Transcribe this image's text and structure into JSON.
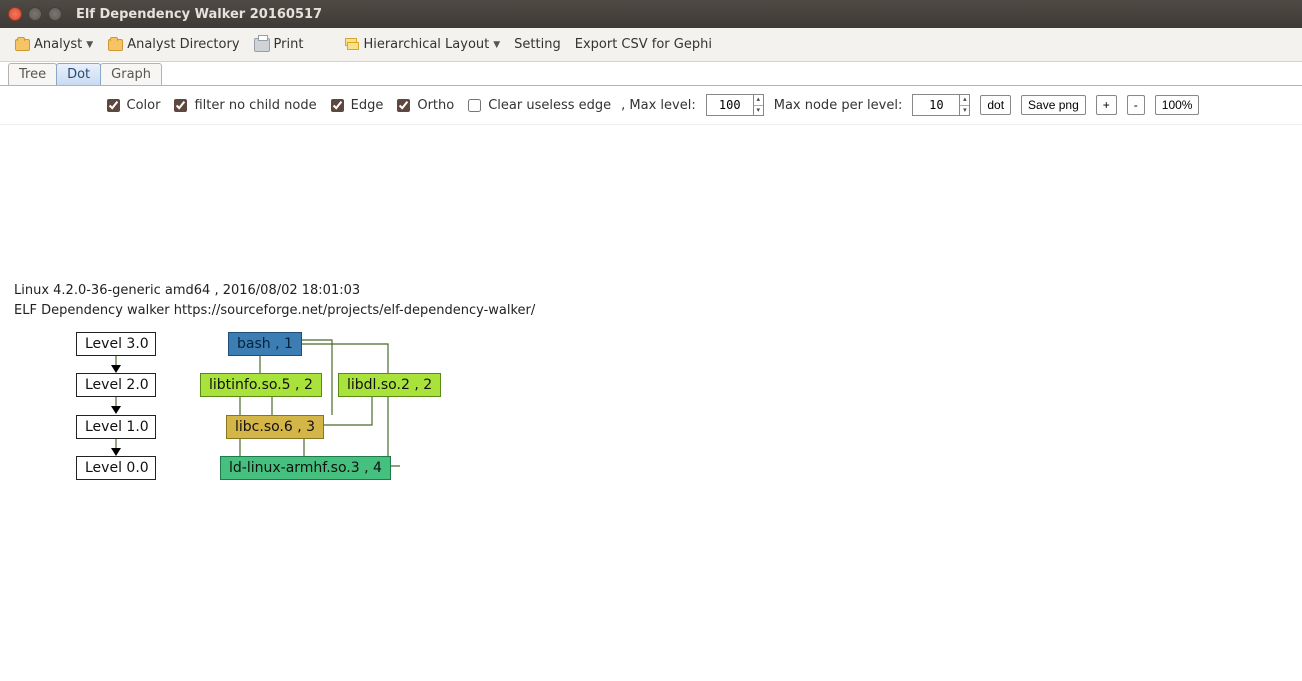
{
  "window": {
    "title": "Elf Dependency Walker 20160517"
  },
  "toolbar": {
    "analyst": "Analyst",
    "analyst_dir": "Analyst Directory",
    "print": "Print",
    "layout": "Hierarchical Layout",
    "setting": "Setting",
    "export": "Export CSV for Gephi"
  },
  "tabs": {
    "tree": "Tree",
    "dot": "Dot",
    "graph": "Graph",
    "active": "dot"
  },
  "controls": {
    "color": "Color",
    "filter": "filter no child node",
    "edge": "Edge",
    "ortho": "Ortho",
    "clear": "Clear useless edge",
    "max_level_label": ", Max level:",
    "max_level_value": "100",
    "max_node_label": "Max node per level:",
    "max_node_value": "10",
    "dot_btn": "dot",
    "save_png": "Save png",
    "plus": "+",
    "minus": "-",
    "zoom": "100%",
    "checked": {
      "color": true,
      "filter": true,
      "edge": true,
      "ortho": true,
      "clear": false
    }
  },
  "info": {
    "line1": "Linux 4.2.0-36-generic amd64 , 2016/08/02 18:01:03",
    "line2": "ELF Dependency walker https://sourceforge.net/projects/elf-dependency-walker/"
  },
  "levels": [
    {
      "label": "Level 3.0"
    },
    {
      "label": "Level 2.0"
    },
    {
      "label": "Level 1.0"
    },
    {
      "label": "Level 0.0"
    }
  ],
  "nodes": {
    "bash": {
      "label": "bash , 1",
      "color": "#3c7db3"
    },
    "libtinfo": {
      "label": "libtinfo.so.5 , 2",
      "color": "#a8e23a"
    },
    "libdl": {
      "label": "libdl.so.2 , 2",
      "color": "#a8e23a"
    },
    "libc": {
      "label": "libc.so.6 , 3",
      "color": "#d4b547"
    },
    "ldlinux": {
      "label": "ld-linux-armhf.so.3 , 4",
      "color": "#45c07e"
    }
  }
}
